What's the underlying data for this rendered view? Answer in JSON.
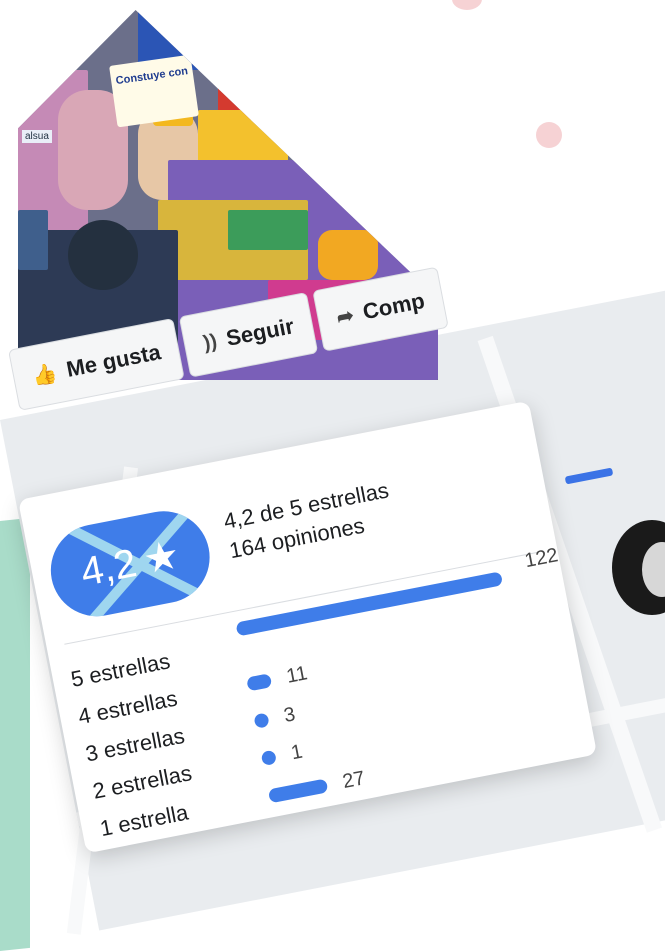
{
  "actions": {
    "like_label": "Me gusta",
    "follow_label": "Seguir",
    "share_label": "Comp"
  },
  "photo": {
    "sign_text": "Constuye con",
    "caption_text": "alsua"
  },
  "rating": {
    "score": "4,2",
    "star_glyph": "★",
    "summary_line": "4,2 de 5 estrellas",
    "count_line": "164 opiniones",
    "rows": [
      {
        "label": "5 estrellas",
        "count": "122",
        "fraction": 1.0
      },
      {
        "label": "4 estrellas",
        "count": "11",
        "fraction": 0.09
      },
      {
        "label": "3 estrellas",
        "count": "3",
        "fraction": 0.025
      },
      {
        "label": "2 estrellas",
        "count": "1",
        "fraction": 0.008
      },
      {
        "label": "1 estrella",
        "count": "27",
        "fraction": 0.22
      }
    ]
  },
  "colors": {
    "accent": "#3f7de9",
    "map": "#e9ecef",
    "mint": "#a9dcc9",
    "pink_dot": "#f6d2d4"
  }
}
